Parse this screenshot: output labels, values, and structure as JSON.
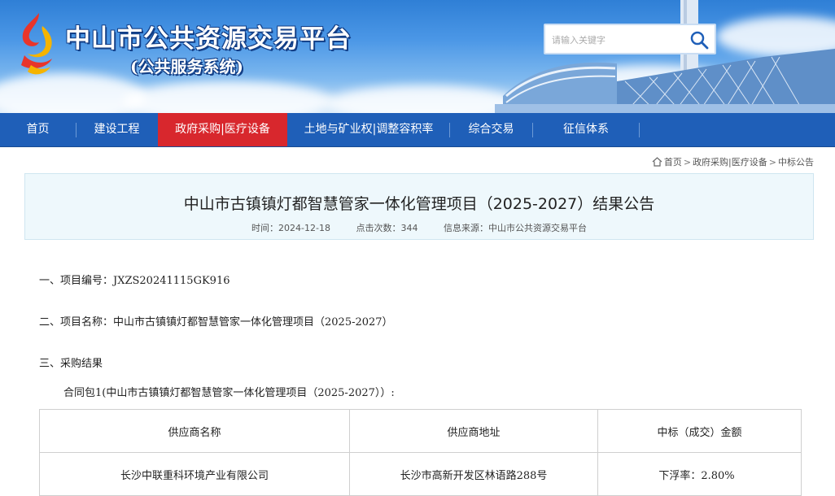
{
  "header": {
    "site_title": "中山市公共资源交易平台",
    "site_subtitle": "(公共服务系统)",
    "search_placeholder": "请输入关键字"
  },
  "nav": {
    "items": [
      {
        "label": "首页",
        "active": false
      },
      {
        "label": "建设工程",
        "active": false
      },
      {
        "label": "政府采购|医疗设备",
        "active": true
      },
      {
        "label": "土地与矿业权|调整容积率",
        "active": false
      },
      {
        "label": "综合交易",
        "active": false
      },
      {
        "label": "征信体系",
        "active": false
      }
    ]
  },
  "breadcrumb": {
    "home": "首页",
    "sep": ">",
    "level1": "政府采购|医疗设备",
    "level2": "中标公告"
  },
  "article": {
    "title": "中山市古镇镇灯都智慧管家一体化管理项目（2025-2027）结果公告",
    "time": "时间：2024-12-18",
    "clicks": "点击次数：344",
    "source": "信息来源：中山市公共资源交易平台"
  },
  "content": {
    "project_no": "一、项目编号：JXZS20241115GK916",
    "project_name": "二、项目名称：中山市古镇镇灯都智慧管家一体化管理项目（2025-2027）",
    "result_heading": "三、采购结果",
    "contract_package": "合同包1(中山市古镇镇灯都智慧管家一体化管理项目（2025-2027））:",
    "table": {
      "headers": [
        "供应商名称",
        "供应商地址",
        "中标（成交）金额"
      ],
      "rows": [
        [
          "长沙中联重科环境产业有限公司",
          "长沙市高新开发区林语路288号",
          "下浮率：2.80%"
        ]
      ]
    }
  },
  "colors": {
    "nav_bg": "#1f5fb8",
    "nav_active": "#d8272d",
    "title_box_bg": "#eef8fc"
  }
}
